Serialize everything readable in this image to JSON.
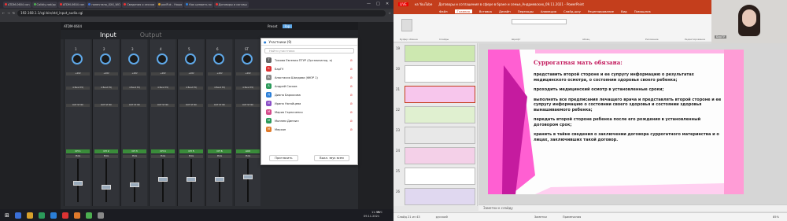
{
  "browser": {
    "tabs": [
      "ATDM-0604 con",
      "Calidiy-rad(sp",
      "ATDM-0604 con",
      "напечтано_XXX_WO",
      "Сведения о сессии",
      "podFuk - Ношо",
      "Как ценаить зо",
      "Договоры и соглаш"
    ],
    "url": "192.168.1.1/cgi-bin/atd_input_audio.cgi",
    "window_controls": [
      "—",
      "□",
      "✕"
    ]
  },
  "mixer": {
    "device": "ATDM-0604",
    "preset_label": "Preset",
    "preset_value": "Top",
    "tabs": [
      "Input",
      "Output"
    ],
    "channels": [
      {
        "num": "1",
        "label": "CH 1",
        "fader": 0.45
      },
      {
        "num": "2",
        "label": "CH 2",
        "fader": 0.35
      },
      {
        "num": "3",
        "label": "CH 3",
        "fader": 0.4
      },
      {
        "num": "4",
        "label": "CH 4",
        "fader": 0.55
      },
      {
        "num": "5",
        "label": "CH 5",
        "fader": 0.55
      },
      {
        "num": "6",
        "label": "CH 6",
        "fader": 0.55
      },
      {
        "num": "ST",
        "label": "AUX",
        "fader": 0.6
      }
    ],
    "eq_label": "4 Band EQ",
    "out_label": "OUT ST NC",
    "mute_label": "Mute",
    "plus48": "+48V"
  },
  "zoom": {
    "title": "Участники (9)",
    "search_placeholder": "Найти участника",
    "participants": [
      {
        "initial": "Т",
        "name": "Тихова Евгения ПТУР (Организатор, я)",
        "color": "#666"
      },
      {
        "initial": "Б",
        "name": "БарГУ",
        "color": "#d33"
      },
      {
        "initial": "А",
        "name": "Анастасия Шандова (ФЮР 1)",
        "color": "#888"
      },
      {
        "initial": "А",
        "name": "Андрей Сосков",
        "color": "#2b9a5a"
      },
      {
        "initial": "Д",
        "name": "Диана Баркосова",
        "color": "#2b7fd8"
      },
      {
        "initial": "И",
        "name": "Ирина Нагайцева",
        "color": "#8a4fc7"
      },
      {
        "initial": "М",
        "name": "Мария Гарниченко",
        "color": "#d34a8a"
      },
      {
        "initial": "М",
        "name": "Молнем Диннил",
        "color": "#2b9a5a"
      },
      {
        "initial": "М",
        "name": "Мерхан",
        "color": "#e07a2b"
      }
    ],
    "invite_label": "Пригласить",
    "mute_all_label": "Выкл. звук всем"
  },
  "taskbar": {
    "time": "11:56",
    "date": "09.11.2021",
    "lang": "РУС"
  },
  "powerpoint": {
    "window_title": "Договоры и соглашения в сфере в браке и семье_Андриевских_09.11.2021 - PowerPoint",
    "live": "LIVE",
    "youtube_tab": "на YouTube",
    "ribbon_tabs": [
      "Файл",
      "Главная",
      "Вставка",
      "Дизайн",
      "Переходы",
      "Анимация",
      "Слайд-шоу",
      "Рецензирование",
      "Вид",
      "Помощник"
    ],
    "active_tab": "Главная",
    "ribbon_groups": [
      "Буфер обмена",
      "Слайды",
      "Шрифт",
      "Абзац",
      "Рисование",
      "Редактирование"
    ],
    "thumbs": [
      {
        "num": "19"
      },
      {
        "num": "20"
      },
      {
        "num": "21"
      },
      {
        "num": "22"
      },
      {
        "num": "23"
      },
      {
        "num": "24"
      },
      {
        "num": "25"
      },
      {
        "num": "26"
      }
    ],
    "slide_heading": "Суррогатная мать обязана:",
    "slide_bullets": [
      "представить второй стороне и ее супругу информацию о результатах медицинского осмотра, о состоянии здоровья своего ребенка;",
      "проходить медицинский осмотр в установленные сроки;",
      "выполнять все предписания лечащего врача и представлять второй стороне и ее супругу информацию о состоянии своего здоровья и состоянии здоровья вынашиваемого ребенка;",
      "передать второй стороне ребенка после его рождения в установленный договором срок;",
      "хранить в тайне сведения о заключении договора суррогатного материнства и о лицах, заключивших такой договор."
    ],
    "notes": "Заметки к слайду",
    "status_slide": "Слайд 21 из 43",
    "status_lang": "русский",
    "status_notes": "Заметки",
    "status_comments": "Примечания",
    "zoom_level": "85%",
    "camera_label": "БарГУ"
  }
}
